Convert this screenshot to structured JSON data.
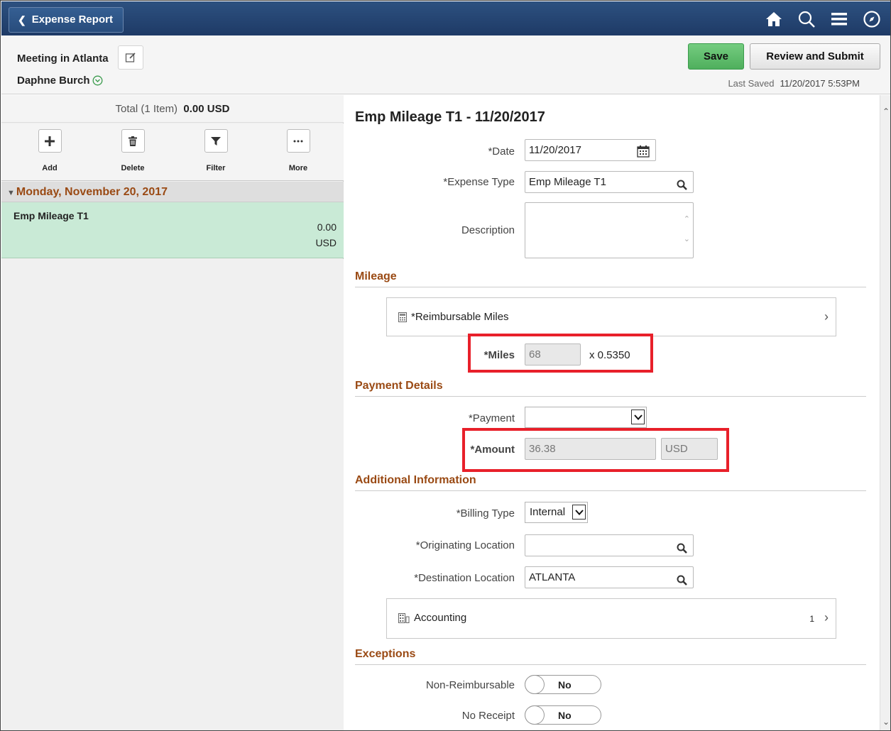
{
  "topbar": {
    "back_label": "Expense Report",
    "icons": [
      "home-icon",
      "search-icon",
      "menu-icon",
      "compass-icon"
    ]
  },
  "header": {
    "report_title": "Meeting in Atlanta",
    "user_name": "Daphne Burch",
    "save_label": "Save",
    "submit_label": "Review and Submit",
    "last_saved_label": "Last Saved",
    "last_saved_value": "11/20/2017  5:53PM"
  },
  "left": {
    "total_label": "Total (1 Item)",
    "total_value": "0.00  USD",
    "tools": {
      "add": "Add",
      "delete": "Delete",
      "filter": "Filter",
      "more": "More"
    },
    "date_group": "Monday, November 20, 2017",
    "item": {
      "name": "Emp Mileage T1",
      "amount": "0.00",
      "currency": "USD"
    }
  },
  "detail": {
    "title": "Emp Mileage T1 - 11/20/2017",
    "date_label": "*Date",
    "date_value": "11/20/2017",
    "expense_type_label": "*Expense Type",
    "expense_type_value": "Emp Mileage T1",
    "description_label": "Description",
    "mileage_section": "Mileage",
    "reimbursable_miles": "*Reimbursable Miles",
    "miles_label": "*Miles",
    "miles_value": "68",
    "multiplier": "x  0.5350",
    "payment_section": "Payment Details",
    "payment_label": "*Payment",
    "payment_value": "",
    "amount_label": "*Amount",
    "amount_value": "36.38",
    "amount_currency": "USD",
    "additional_section": "Additional Information",
    "billing_type_label": "*Billing Type",
    "billing_type_value": "Internal",
    "origin_label": "*Originating Location",
    "origin_value": "",
    "destination_label": "*Destination Location",
    "destination_value": "ATLANTA",
    "accounting_label": "Accounting",
    "accounting_count": "1",
    "exceptions_section": "Exceptions",
    "non_reimbursable_label": "Non-Reimbursable",
    "non_reimbursable_value": "No",
    "no_receipt_label": "No Receipt",
    "no_receipt_value": "No"
  },
  "colors": {
    "topbar": "#1e3a66",
    "accent_brown": "#9a4a14",
    "save_green": "#4faf5d",
    "selected_row": "#c9ead6",
    "highlight": "#e8202a"
  }
}
